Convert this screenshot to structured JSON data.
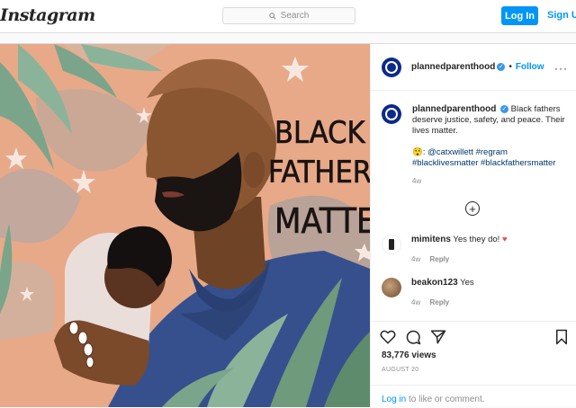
{
  "header": {
    "logo": "Instagram",
    "search_placeholder": "Search",
    "login_label": "Log In",
    "signup_label": "Sign Up"
  },
  "post": {
    "artwork_text": [
      "BLACK",
      "FATHERS",
      "MATTER"
    ],
    "author": "plannedparenthood",
    "follow_label": "Follow",
    "caption": {
      "user": "plannedparenthood",
      "text": "Black fathers deserve justice, safety, and peace. Their lives matter.",
      "emoji": "😲",
      "line2_mention": "@catxwillett",
      "line2_tags": "#regram #blacklivesmatter #blackfathersmatter",
      "time": "4w"
    },
    "comments": [
      {
        "user": "mimitens",
        "text": "Yes they do!",
        "heart": "♥",
        "time": "4w",
        "reply": "Reply"
      },
      {
        "user": "beakon123",
        "text": "Yes",
        "time": "4w",
        "reply": "Reply"
      }
    ],
    "views": "83,776 views",
    "date": "AUGUST 20",
    "login_prompt_link": "Log in",
    "login_prompt_text": " to like or comment."
  },
  "colors": {
    "accent": "#0095f6",
    "avatar_bg": "#0b2a8a",
    "artwork_bg": "#e8a989",
    "heart": "#ed4956"
  }
}
